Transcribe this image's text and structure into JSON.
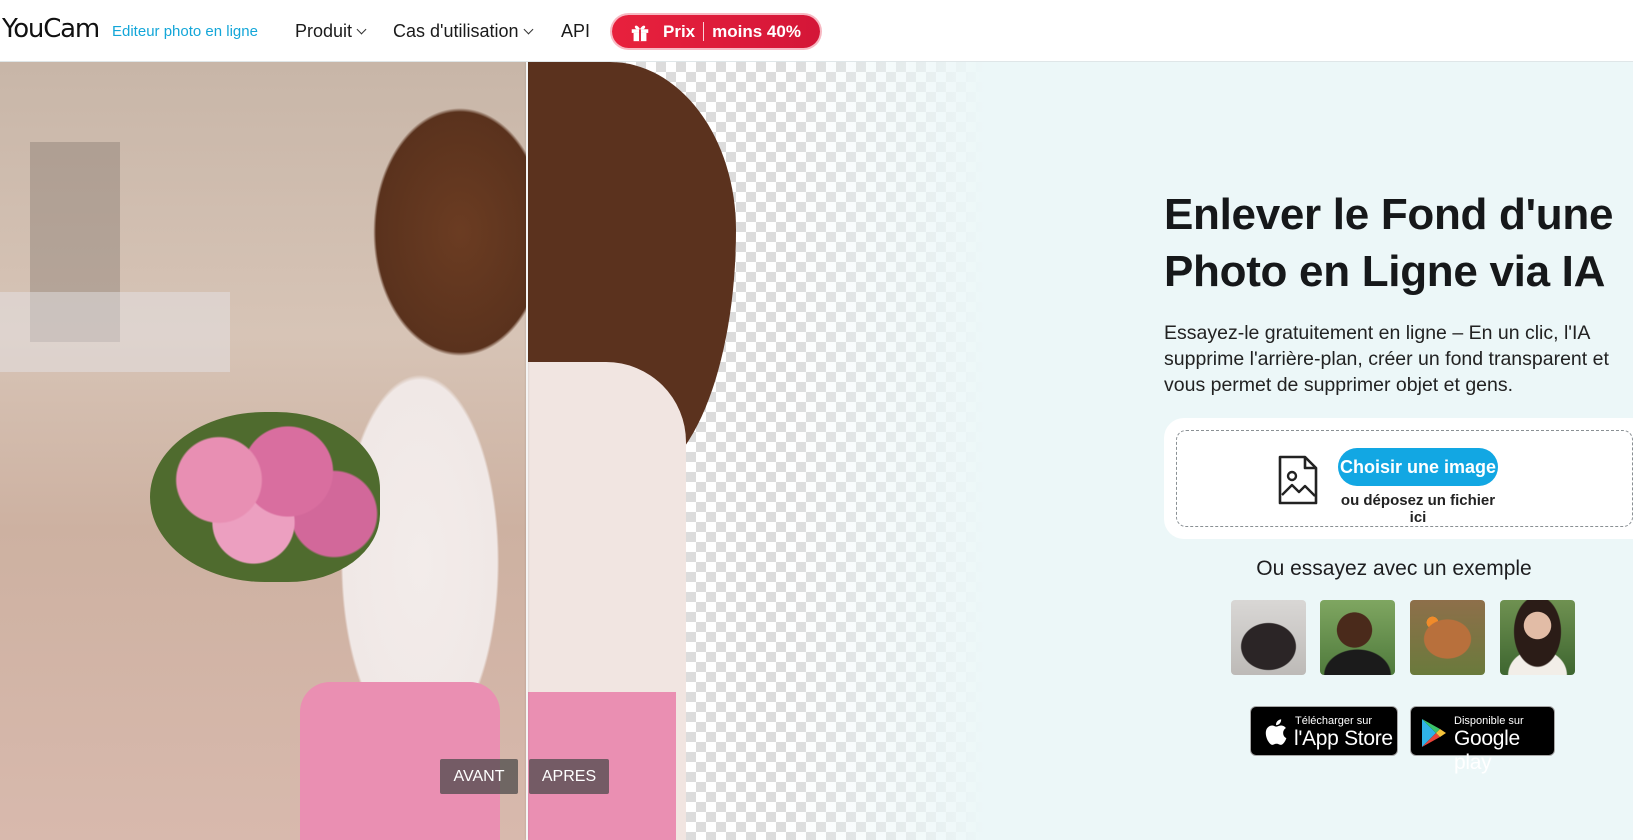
{
  "nav": {
    "logo": "YouCam",
    "tagline": "Editeur photo en ligne",
    "items": [
      {
        "label": "Produit",
        "dropdown": true
      },
      {
        "label": "Cas d'utilisation",
        "dropdown": true
      },
      {
        "label": "API",
        "dropdown": false
      }
    ],
    "promo": {
      "left": "Prix",
      "right": "moins 40%",
      "icon": "gift-icon",
      "color": "#e01c3b"
    }
  },
  "hero": {
    "before_label": "AVANT",
    "after_label": "APRES",
    "title": "Enlever le Fond d'une Photo en Ligne via IA",
    "subtitle": "Essayez-le gratuitement en ligne – En un clic, l'IA supprime l'arrière-plan, créer un fond transparent et vous permet de supprimer objet et gens.",
    "upload": {
      "button_label": "Choisir une image",
      "drop_text": "ou déposez un fichier ici",
      "icon": "image-file-icon"
    },
    "examples_title": "Ou essayez avec un exemple",
    "examples": [
      {
        "name": "handbag"
      },
      {
        "name": "man"
      },
      {
        "name": "dog"
      },
      {
        "name": "woman"
      }
    ],
    "stores": [
      {
        "small": "Télécharger sur",
        "big": "l'App Store",
        "icon": "apple-icon"
      },
      {
        "small": "Disponible sur",
        "big": "Google play",
        "icon": "google-play-icon"
      }
    ]
  },
  "colors": {
    "accent": "#12a7e3",
    "promo": "#e01c3b",
    "hero_bg": "#ecf7f8"
  }
}
